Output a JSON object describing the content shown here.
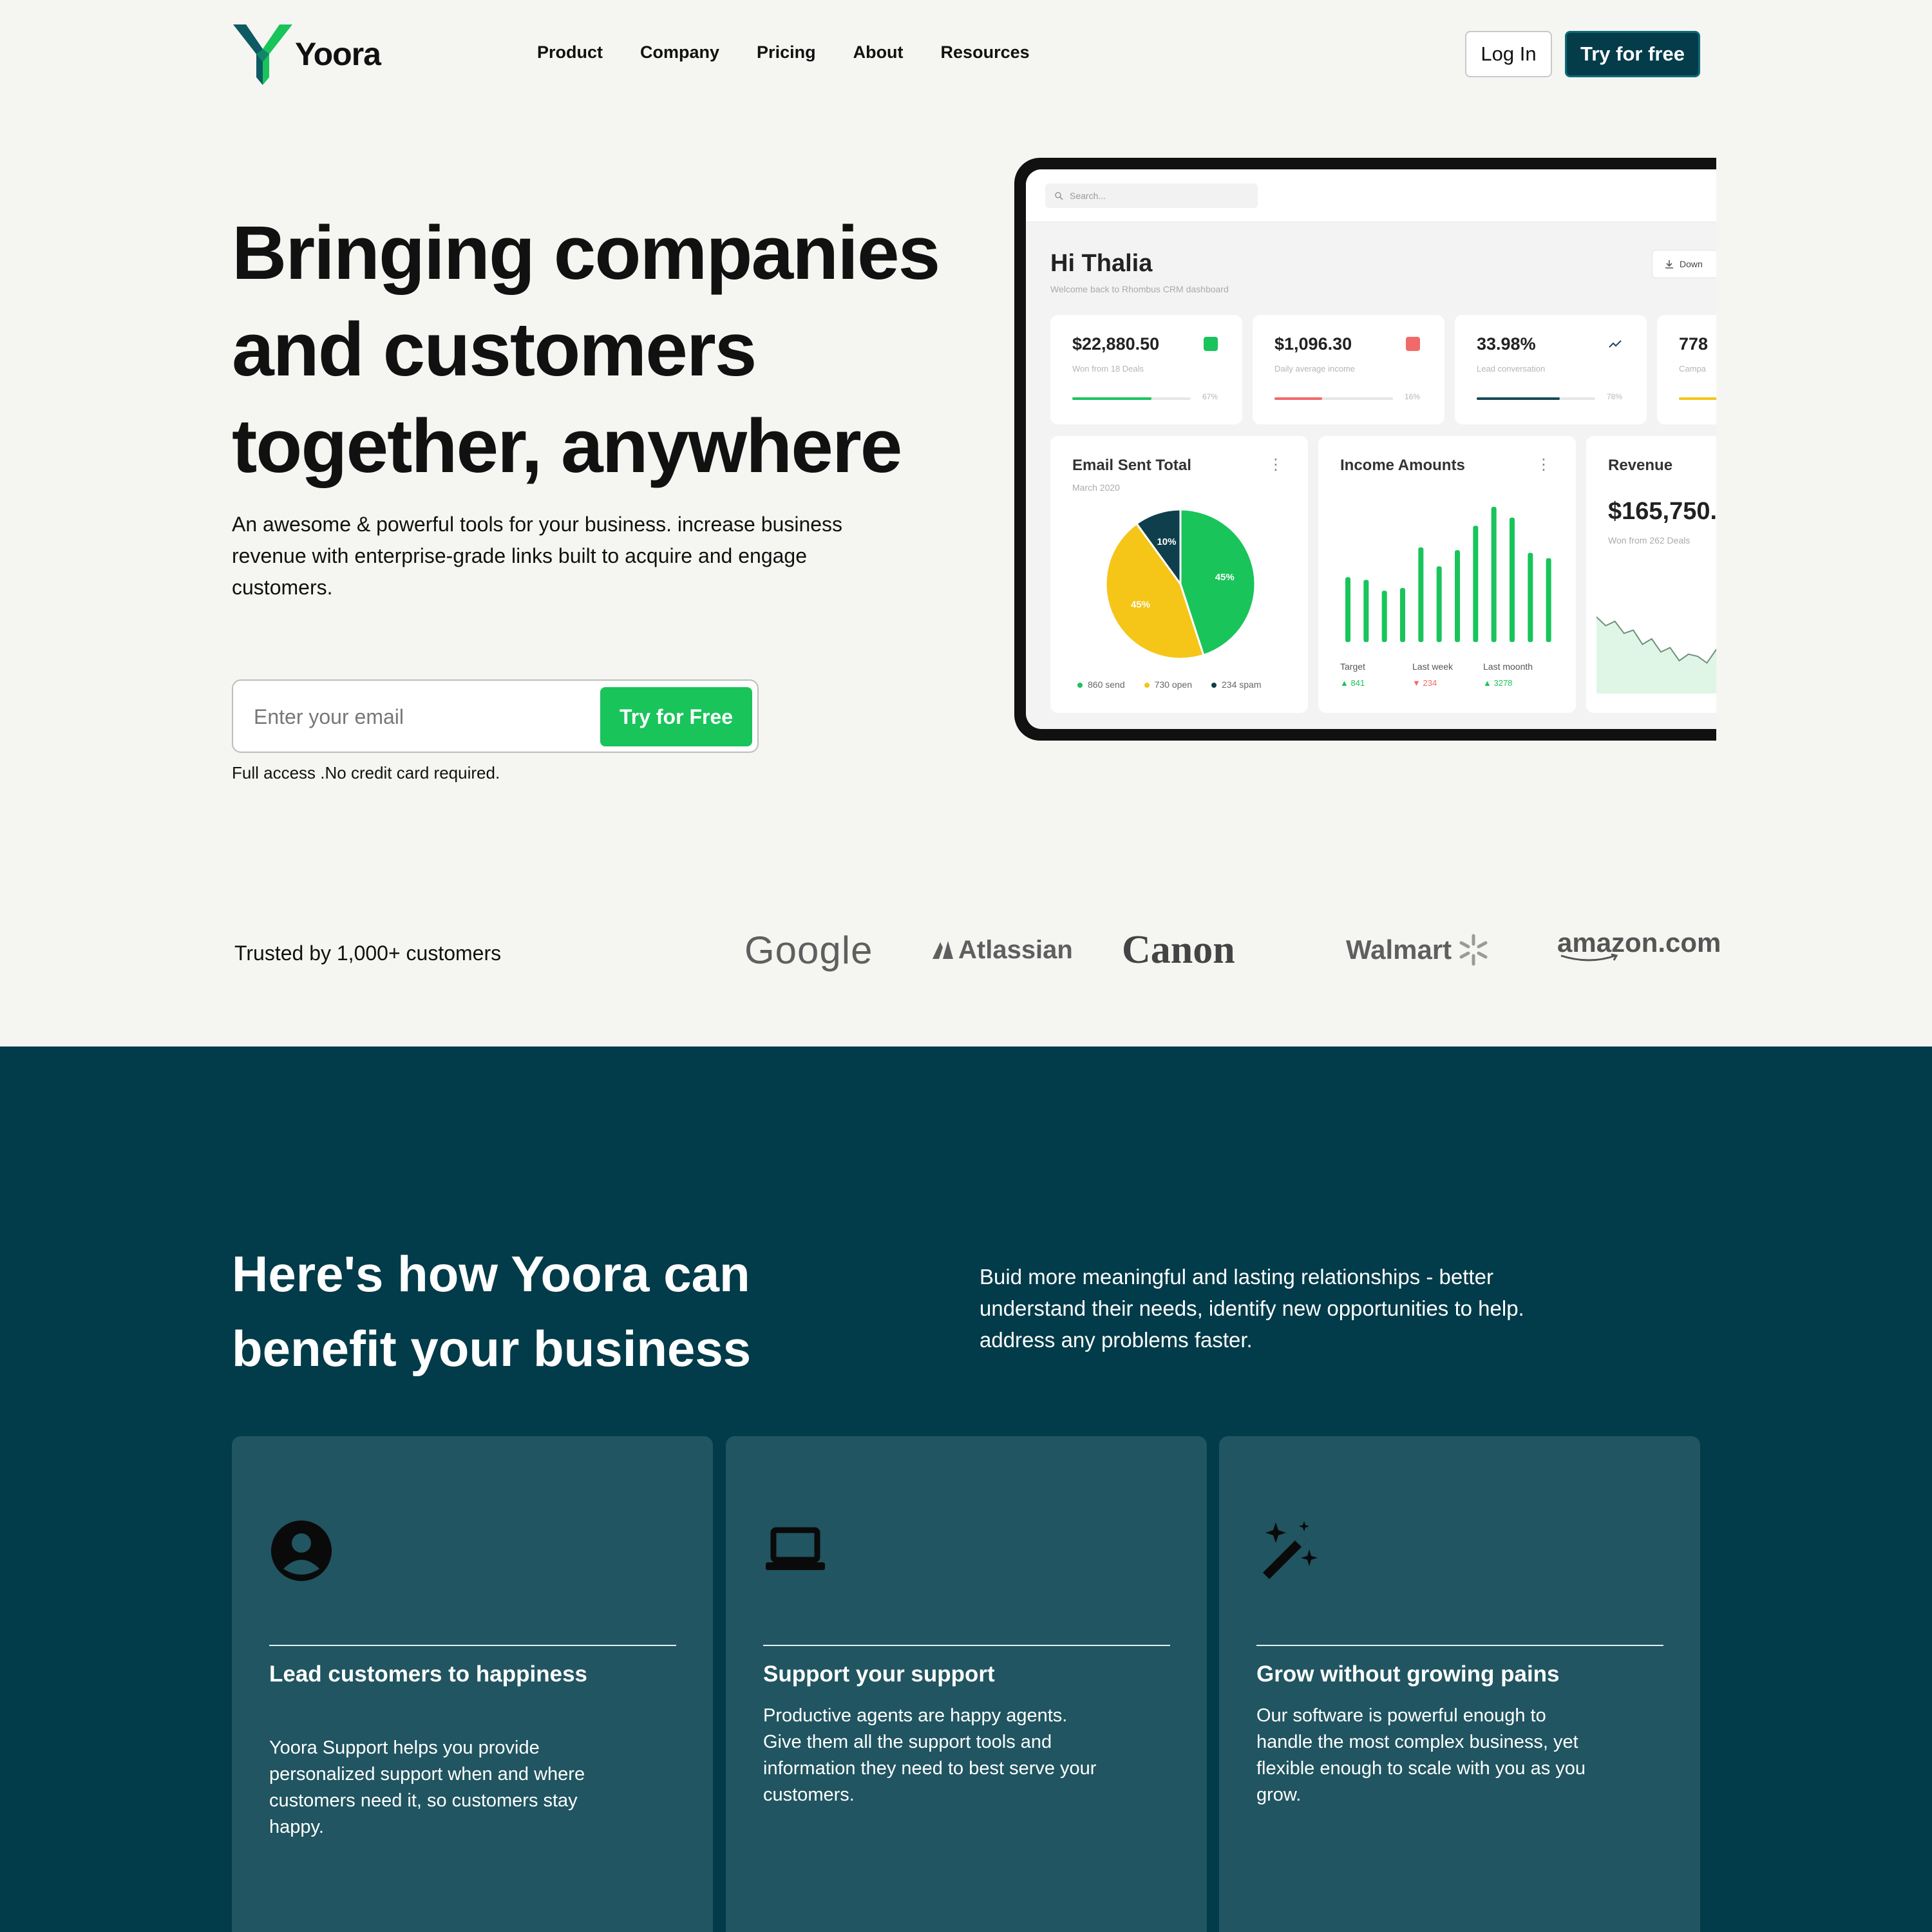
{
  "header": {
    "brand": "Yoora",
    "nav": [
      "Product",
      "Company",
      "Pricing",
      "About",
      "Resources"
    ],
    "login_label": "Log In",
    "try_label": "Try for free"
  },
  "hero": {
    "title_lines": [
      "Bringing companies",
      "and customers",
      "together, anywhere"
    ],
    "subtitle": "An awesome & powerful tools for your business. increase business revenue with enterprise-grade links built to acquire and engage customers.",
    "email_placeholder": "Enter your email",
    "cta_label": "Try for Free",
    "note": "Full access .No credit card required."
  },
  "dashboard": {
    "search_placeholder": "Search...",
    "greeting": "Hi Thalia",
    "welcome": "Welcome back to Rhombus CRM dashboard",
    "download_label": "Down",
    "stats": [
      {
        "value": "$22,880.50",
        "label": "Won from 18 Deals",
        "pct": "67%",
        "fill": 0.67,
        "color": "#19c45b"
      },
      {
        "value": "$1,096.30",
        "label": "Daily average income",
        "pct": "16%",
        "fill": 0.4,
        "color": "#f06a6a"
      },
      {
        "value": "33.98%",
        "label": "Lead conversation",
        "pct": "78%",
        "fill": 0.7,
        "color": "#174a57"
      },
      {
        "value": "778",
        "label": "Campa",
        "pct": "",
        "fill": 0.5,
        "color": "#f5c518"
      }
    ],
    "email_card": {
      "title": "Email Sent Total",
      "subtitle": "March 2020",
      "pie": [
        {
          "label": "10%",
          "value": 10,
          "color": "#0f3f4c"
        },
        {
          "label": "45%",
          "value": 45,
          "color": "#19c45b"
        },
        {
          "label": "45%",
          "value": 45,
          "color": "#f5c518"
        }
      ],
      "legend": [
        {
          "text": "860 send",
          "color": "#19c45b"
        },
        {
          "text": "730 open",
          "color": "#f5c518"
        },
        {
          "text": "234 spam",
          "color": "#0f3f4c"
        }
      ]
    },
    "income_card": {
      "title": "Income Amounts",
      "bars": [
        0.48,
        0.46,
        0.38,
        0.4,
        0.7,
        0.56,
        0.68,
        0.86,
        1.0,
        0.92,
        0.66,
        0.62
      ],
      "labels": [
        "Target",
        "Last week",
        "Last moonth"
      ],
      "values": [
        "841",
        "234",
        "3278"
      ],
      "value_colors": [
        "#19c45b",
        "#f06a6a",
        "#19c45b"
      ]
    },
    "revenue_card": {
      "title": "Revenue",
      "value": "$165,750.",
      "subtitle": "Won from 262 Deals",
      "line": [
        0.7,
        0.62,
        0.66,
        0.55,
        0.58,
        0.45,
        0.5,
        0.38,
        0.42,
        0.3,
        0.36,
        0.34,
        0.28,
        0.4,
        0.52
      ]
    }
  },
  "trusted": {
    "label": "Trusted by 1,000+ customers",
    "brands": [
      "Google",
      "Atlassian",
      "Canon",
      "Walmart",
      "amazon.com"
    ]
  },
  "benefits": {
    "title_lines": [
      "Here's how Yoora can",
      "benefit your business"
    ],
    "description": "Buid more meaningful and lasting relationships - better understand their needs, identify new opportunities to help. address any problems faster.",
    "cards": [
      {
        "icon": "user-circle-icon",
        "title": "Lead customers to happiness",
        "text": "Yoora Support helps you provide personalized support when and where customers need it, so customers stay happy."
      },
      {
        "icon": "laptop-icon",
        "title": "Support your support",
        "text": "Productive agents are happy agents. Give them all the support tools and information they need to best serve your customers."
      },
      {
        "icon": "magic-wand-icon",
        "title": "Grow without growing pains",
        "text": "Our software is powerful enough to handle the most complex business, yet flexible enough to scale with you as you grow."
      }
    ]
  },
  "colors": {
    "brand_teal": "#023b49",
    "card_teal": "#205561",
    "accent_green": "#19c45b"
  }
}
